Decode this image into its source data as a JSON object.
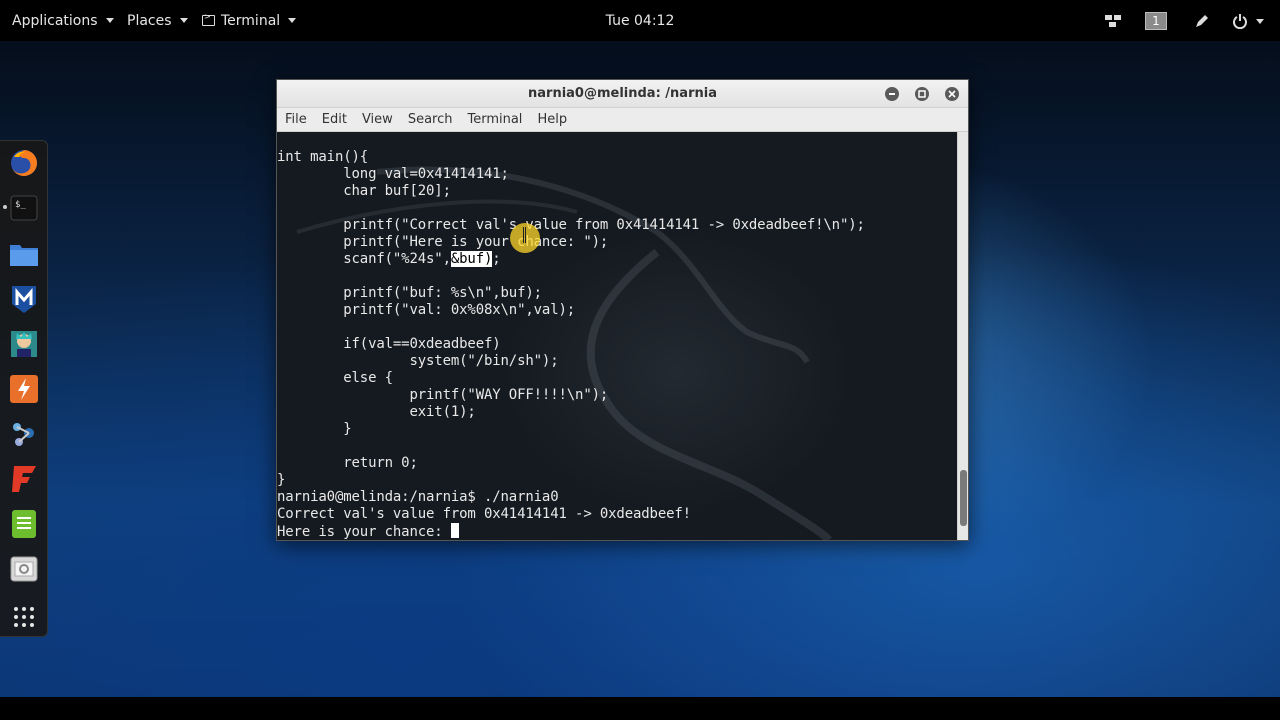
{
  "topbar": {
    "applications": "Applications",
    "places": "Places",
    "terminal": "Terminal",
    "clock": "Tue 04:12",
    "workspace": "1",
    "icons": [
      "network-icon",
      "workspace-indicator",
      "pen-icon",
      "power-icon"
    ]
  },
  "dock": {
    "items": [
      "firefox-icon",
      "terminal-icon",
      "files-icon",
      "metasploit-icon",
      "armitage-icon",
      "burpsuite-icon",
      "maltego-icon",
      "faraday-icon",
      "leafpad-icon",
      "cutycapt-icon",
      "app-grid-icon"
    ]
  },
  "window": {
    "title": "narnia0@melinda: /narnia",
    "menu": [
      "File",
      "Edit",
      "View",
      "Search",
      "Terminal",
      "Help"
    ]
  },
  "terminal": {
    "lines": [
      "int main(){",
      "        long val=0x41414141;",
      "        char buf[20];",
      "",
      "        printf(\"Correct val's value from 0x41414141 -> 0xdeadbeef!\\n\");",
      "        printf(\"Here is your chance: \");",
      "        scanf(\"%24s\",",
      "",
      "        printf(\"buf: %s\\n\",buf);",
      "        printf(\"val: 0x%08x\\n\",val);",
      "",
      "        if(val==0xdeadbeef)",
      "                system(\"/bin/sh\");",
      "        else {",
      "                printf(\"WAY OFF!!!!\\n\");",
      "                exit(1);",
      "        }",
      "",
      "        return 0;",
      "}",
      "narnia0@melinda:/narnia$ ./narnia0",
      "Correct val's value from 0x41414141 -> 0xdeadbeef!",
      "Here is your chance: "
    ],
    "selected_text": "&buf)",
    "after_selection": ";"
  }
}
